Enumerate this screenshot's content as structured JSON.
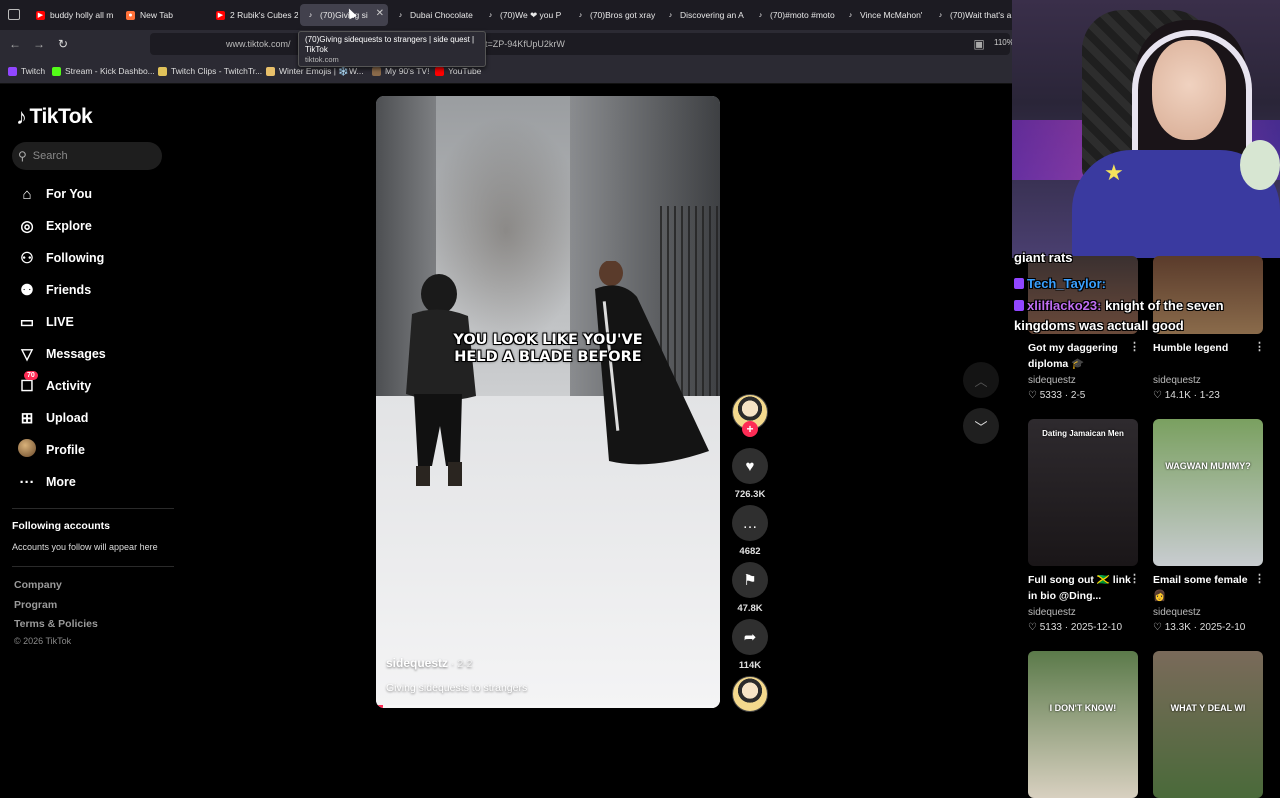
{
  "browser": {
    "tabs": [
      {
        "title": "buddy holly all m",
        "icon": "youtube",
        "color": "#ff0000"
      },
      {
        "title": "New Tab",
        "icon": "firefox",
        "color": "#ff7139"
      },
      {
        "title": "2 Rubik's Cubes 2",
        "icon": "youtube",
        "color": "#ff0000"
      },
      {
        "title": "(70)Giving si",
        "icon": "tiktok",
        "color": "#ffffff",
        "active": true
      },
      {
        "title": "Dubai Chocolate",
        "icon": "tiktok",
        "color": "#ffffff"
      },
      {
        "title": "(70)We ❤ you P",
        "icon": "tiktok",
        "color": "#ffffff"
      },
      {
        "title": "(70)Bros got xray",
        "icon": "tiktok",
        "color": "#ffffff"
      },
      {
        "title": "Discovering an A",
        "icon": "tiktok",
        "color": "#ffffff"
      },
      {
        "title": "(70)#moto #moto",
        "icon": "tiktok",
        "color": "#ffffff"
      },
      {
        "title": "Vince McMahon'",
        "icon": "tiktok",
        "color": "#ffffff"
      },
      {
        "title": "(70)Wait that's a",
        "icon": "tiktok",
        "color": "#ffffff"
      }
    ],
    "url": "www.tiktok.com/",
    "url_tail": "1&_t=ZP-94KfUpU2krW",
    "zoom": "110%",
    "tooltip": {
      "title": "(70)Giving sidequests to strangers | side quest | TikTok",
      "domain": "tiktok.com"
    },
    "bookmarks": [
      {
        "label": "Twitch",
        "color": "#9146ff"
      },
      {
        "label": "Stream - Kick Dashbo...",
        "color": "#53fc18"
      },
      {
        "label": "Twitch Clips - TwitchTr...",
        "color": "#e0c25a"
      },
      {
        "label": "Winter Emojis | ❄️W...",
        "color": "#e8c06a"
      },
      {
        "label": "My 90's TV!",
        "color": "#8a6a4a"
      },
      {
        "label": "YouTube",
        "color": "#ff0000"
      }
    ]
  },
  "sidebar": {
    "logo": "TikTok",
    "search_placeholder": "Search",
    "nav": [
      {
        "label": "For You",
        "icon": "home-icon",
        "glyph": "⌂"
      },
      {
        "label": "Explore",
        "icon": "compass-icon",
        "glyph": "◎"
      },
      {
        "label": "Following",
        "icon": "person-follow-icon",
        "glyph": "⚇"
      },
      {
        "label": "Friends",
        "icon": "friends-icon",
        "glyph": "⚉"
      },
      {
        "label": "LIVE",
        "icon": "live-icon",
        "glyph": "▭"
      },
      {
        "label": "Messages",
        "icon": "send-icon",
        "glyph": "▽"
      },
      {
        "label": "Activity",
        "icon": "activity-icon",
        "glyph": "☐",
        "badge": "70"
      },
      {
        "label": "Upload",
        "icon": "upload-icon",
        "glyph": "⊞"
      },
      {
        "label": "Profile",
        "icon": "profile-avatar",
        "glyph": ""
      },
      {
        "label": "More",
        "icon": "more-icon",
        "glyph": "···"
      }
    ],
    "following_title": "Following accounts",
    "following_sub": "Accounts you follow will appear here",
    "footer_links": [
      "Company",
      "Program",
      "Terms & Policies"
    ],
    "copyright": "© 2026 TikTok"
  },
  "video": {
    "caption_line1": "YOU LOOK LIKE YOU'VE",
    "caption_line2": "HELD A BLADE BEFORE",
    "author": "sidequestz",
    "date": " · 2-2",
    "description": "Giving sidequests to strangers",
    "progress": 0.02,
    "likes": "726.3K",
    "comments": "4682",
    "saves": "47.8K",
    "shares": "114K"
  },
  "overlay": {
    "chat": [
      {
        "name": "",
        "text": "giant rats"
      },
      {
        "name": "Tech_Taylor:",
        "text": ""
      },
      {
        "name": "xlilflacko23:",
        "text": "knight of the seven"
      },
      {
        "name": "",
        "text": "kingdoms was actuall good"
      }
    ]
  },
  "recommendations": [
    {
      "title": "Got my daggering diploma 🎓",
      "author": "sidequestz",
      "likes": "5333",
      "date": "2-5",
      "thumb_text": "",
      "colors": [
        "#3a3030",
        "#6a4a3a"
      ]
    },
    {
      "title": "Humble legend",
      "author": "sidequestz",
      "likes": "14.1K",
      "date": "1-23",
      "thumb_text": "",
      "colors": [
        "#5a3b2b",
        "#8a6b4b"
      ]
    },
    {
      "title": "Full song out 🇯🇲 link in bio @Ding...",
      "author": "sidequestz",
      "likes": "5133",
      "date": "2025-12-10",
      "thumb_text": "Dating Jamaican Men",
      "colors": [
        "#2e2a2e",
        "#1a1618"
      ]
    },
    {
      "title": "Email some female 👩",
      "author": "sidequestz",
      "likes": "13.3K",
      "date": "2025-2-10",
      "thumb_text": "WAGWAN MUMMY?",
      "colors": [
        "#7aa060",
        "#c8ccd0"
      ]
    },
    {
      "title": "",
      "author": "",
      "likes": "",
      "date": "",
      "thumb_text": "I DON'T KNOW!",
      "colors": [
        "#5b7a4a",
        "#d8d0c0"
      ]
    },
    {
      "title": "",
      "author": "",
      "likes": "",
      "date": "",
      "thumb_text": "WHAT Y DEAL WI",
      "colors": [
        "#7a6a5a",
        "#4a6a3a"
      ]
    }
  ]
}
